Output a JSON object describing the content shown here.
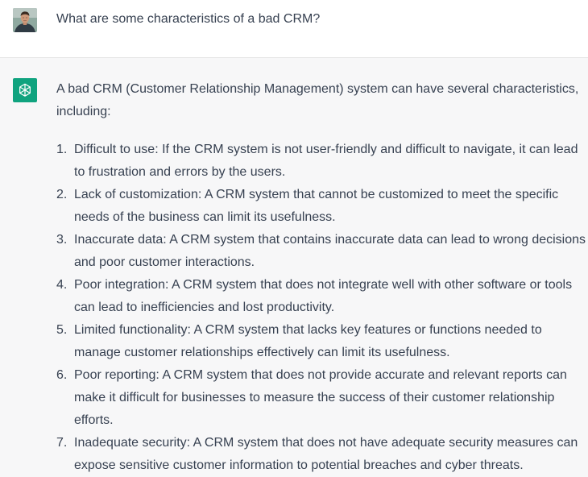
{
  "user_message": {
    "avatar_icon": "user-photo-avatar",
    "text": "What are some characteristics of a bad CRM?"
  },
  "assistant_message": {
    "avatar_icon": "openai-logo-icon",
    "intro": "A bad CRM (Customer Relationship Management) system can have several characteristics, including:",
    "items": [
      {
        "num": "1.",
        "text": "Difficult to use: If the CRM system is not user-friendly and difficult to navigate, it can lead to frustration and errors by the users."
      },
      {
        "num": "2.",
        "text": "Lack of customization: A CRM system that cannot be customized to meet the specific needs of the business can limit its usefulness."
      },
      {
        "num": "3.",
        "text": "Inaccurate data: A CRM system that contains inaccurate data can lead to wrong decisions and poor customer interactions."
      },
      {
        "num": "4.",
        "text": "Poor integration: A CRM system that does not integrate well with other software or tools can lead to inefficiencies and lost productivity."
      },
      {
        "num": "5.",
        "text": "Limited functionality: A CRM system that lacks key features or functions needed to manage customer relationships effectively can limit its usefulness."
      },
      {
        "num": "6.",
        "text": "Poor reporting: A CRM system that does not provide accurate and relevant reports can make it difficult for businesses to measure the success of their customer relationship efforts."
      },
      {
        "num": "7.",
        "text": "Inadequate security: A CRM system that does not have adequate security measures can expose sensitive customer information to potential breaches and cyber threats."
      }
    ]
  },
  "colors": {
    "assistant_avatar_bg": "#10a37f",
    "assistant_row_bg": "#f7f7f8",
    "user_row_bg": "#ffffff",
    "text": "#374151"
  }
}
